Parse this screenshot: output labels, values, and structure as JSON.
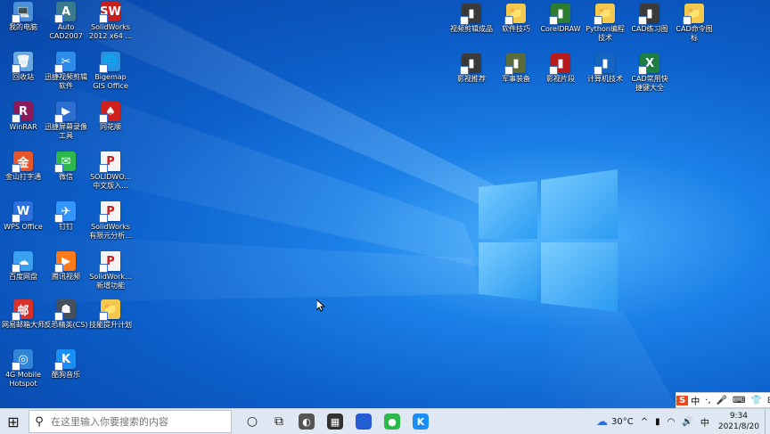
{
  "desktop_icons": [
    {
      "label": "我的电脑",
      "glyph": "💻",
      "bg": "#4a90d9"
    },
    {
      "label": "回收站",
      "glyph": "🗑",
      "bg": "#6aa9e0"
    },
    {
      "label": "WinRAR",
      "glyph": "R",
      "bg": "#8b1a5c"
    },
    {
      "label": "金山打字通",
      "glyph": "金",
      "bg": "#e6562a"
    },
    {
      "label": "WPS Office",
      "glyph": "W",
      "bg": "#2b6fe0"
    },
    {
      "label": "百度网盘",
      "glyph": "☁",
      "bg": "#3aa0f0"
    },
    {
      "label": "网易邮箱大师",
      "glyph": "邮",
      "bg": "#d9302a"
    },
    {
      "label": "4G Mobile\nHotspot",
      "glyph": "◎",
      "bg": "#2f86d8"
    },
    {
      "label": "Auto\nCAD2007",
      "glyph": "A",
      "bg": "#3a7a8f"
    },
    {
      "label": "迅捷视频剪辑\n软件",
      "glyph": "✂",
      "bg": "#2d8ce8"
    },
    {
      "label": "迅捷屏幕录像\n工具",
      "glyph": "▶",
      "bg": "#2c6fd1"
    },
    {
      "label": "微信",
      "glyph": "✉",
      "bg": "#2db84c"
    },
    {
      "label": "钉钉",
      "glyph": "✈",
      "bg": "#3296fa"
    },
    {
      "label": "腾讯视频",
      "glyph": "▶",
      "bg": "#ff7a1a"
    },
    {
      "label": "反恐精英(CS)",
      "glyph": "☗",
      "bg": "#46505c"
    },
    {
      "label": "酷狗音乐",
      "glyph": "K",
      "bg": "#1b8ef5"
    },
    {
      "label": "SolidWorks\n2012 x64 ...",
      "glyph": "SW",
      "bg": "#c8201c"
    },
    {
      "label": "Bigemap\nGIS Office",
      "glyph": "🌐",
      "bg": "#2a8fdc"
    },
    {
      "label": "同花顺",
      "glyph": "♠",
      "bg": "#d0201c"
    },
    {
      "label": "SOLIDWO...\n中文版入...",
      "glyph": "P",
      "bg": "#ffffff"
    },
    {
      "label": "SolidWorks\n有限元分析...",
      "glyph": "P",
      "bg": "#ffffff"
    },
    {
      "label": "SolidWork...\n新增功能",
      "glyph": "P",
      "bg": "#ffffff"
    },
    {
      "label": "技能提升计划",
      "glyph": "📁",
      "bg": "#f2c94c"
    },
    {
      "label": "视频剪辑成品",
      "glyph": "▮",
      "bg": "#3a3a3a"
    },
    {
      "label": "软件技巧",
      "glyph": "📁",
      "bg": "#f2c94c"
    },
    {
      "label": "CorelDRAW",
      "glyph": "▮",
      "bg": "#2e7d32"
    },
    {
      "label": "Python编程\n技术",
      "glyph": "📁",
      "bg": "#f2c94c"
    },
    {
      "label": "CAD练习图",
      "glyph": "▮",
      "bg": "#3a3a3a"
    },
    {
      "label": "CAD命令图\n标",
      "glyph": "📁",
      "bg": "#f2c94c"
    },
    {
      "label": "影视推荐",
      "glyph": "▮",
      "bg": "#3a3a3a"
    },
    {
      "label": "军事装备",
      "glyph": "▮",
      "bg": "#5b6b3a"
    },
    {
      "label": "影视片段",
      "glyph": "▮",
      "bg": "#b71c1c"
    },
    {
      "label": "计算机技术",
      "glyph": "▮",
      "bg": "#1565c0"
    },
    {
      "label": "CAD常用快\n捷键大全",
      "glyph": "X",
      "bg": "#1e7e45"
    }
  ],
  "taskbar": {
    "start_glyph": "⊞",
    "search_glyph": "⚲",
    "search_placeholder": "在这里输入你要搜索的内容",
    "cortana_glyph": "○",
    "taskview_glyph": "⧉",
    "pinned": [
      {
        "glyph": "◐",
        "bg": "#555555",
        "name": "photos-icon"
      },
      {
        "glyph": "▦",
        "bg": "#333333",
        "name": "calculator-icon"
      },
      {
        "glyph": "🐾",
        "bg": "#2a5bd7",
        "name": "baidu-icon"
      },
      {
        "glyph": "●",
        "bg": "#2db84c",
        "name": "wechat-icon"
      },
      {
        "glyph": "K",
        "bg": "#1b8ef5",
        "name": "kugou-icon"
      }
    ]
  },
  "tray": {
    "weather_glyph": "☁",
    "temperature": "30°C",
    "caret_glyph": "^",
    "battery_glyph": "▮",
    "network_glyph": "◠",
    "volume_glyph": "🔊",
    "lang": "中",
    "time": "9:34",
    "date": "2021/8/20"
  },
  "ime": {
    "logo": "S",
    "lang": "中",
    "punct": "·,",
    "mic": "🎤",
    "keyboard": "⌨",
    "skin": "👕",
    "grid": "⊞"
  }
}
